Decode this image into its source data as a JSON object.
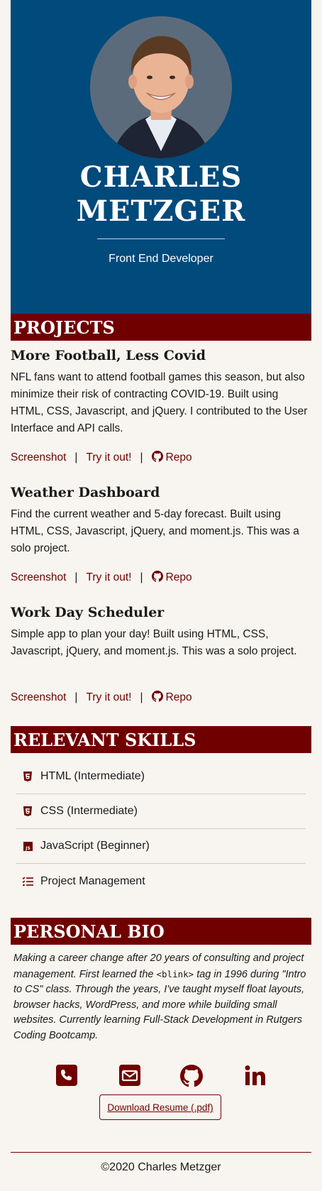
{
  "hero": {
    "name_line1": "CHARLES",
    "name_line2": "METZGER",
    "title": "Front End Developer"
  },
  "projects": {
    "heading": "PROJECTS",
    "items": [
      {
        "title": "More Football, Less Covid",
        "description": "NFL fans want to attend football games this season, but also minimize their risk of contracting COVID-19. Built using HTML, CSS, Javascript, and jQuery. I contributed to the User Interface and API calls.",
        "link_screenshot": "Screenshot",
        "link_demo": "Try it out!",
        "link_repo": "Repo"
      },
      {
        "title": "Weather Dashboard",
        "description": "Find the current weather and 5-day forecast. Built using HTML, CSS, Javascript, jQuery, and moment.js. This was a solo project.",
        "link_screenshot": "Screenshot",
        "link_demo": "Try it out!",
        "link_repo": "Repo"
      },
      {
        "title": "Work Day Scheduler",
        "description": "Simple app to plan your day! Built using HTML, CSS, Javascript, jQuery, and moment.js. This was a solo project.",
        "link_screenshot": "Screenshot",
        "link_demo": "Try it out!",
        "link_repo": "Repo"
      }
    ],
    "separator": "|"
  },
  "skills": {
    "heading": "RELEVANT SKILLS",
    "items": [
      {
        "label": "HTML (Intermediate)",
        "icon": "html5-icon"
      },
      {
        "label": "CSS (Intermediate)",
        "icon": "css3-icon"
      },
      {
        "label": "JavaScript (Beginner)",
        "icon": "js-icon"
      },
      {
        "label": "Project Management",
        "icon": "tasks-icon"
      }
    ]
  },
  "bio": {
    "heading": "PERSONAL BIO",
    "text_before": "Making a career change after 20 years of consulting and project management. First learned the ",
    "code": "<blink>",
    "text_after": " tag in 1996 during \"Intro to CS\" class. Through the years, I've taught myself float layouts, browser hacks, WordPress, and more while building small websites. Currently learning Full-Stack Development in Rutgers Coding Bootcamp."
  },
  "contact": {
    "icons": [
      "phone-icon",
      "envelope-icon",
      "github-icon",
      "linkedin-icon"
    ],
    "resume_label": "Download Resume (.pdf)"
  },
  "footer": {
    "copyright": "©2020 Charles Metzger"
  },
  "colors": {
    "hero_bg": "#004a7c",
    "accent": "#700000",
    "page_bg": "#f8f5f0"
  }
}
